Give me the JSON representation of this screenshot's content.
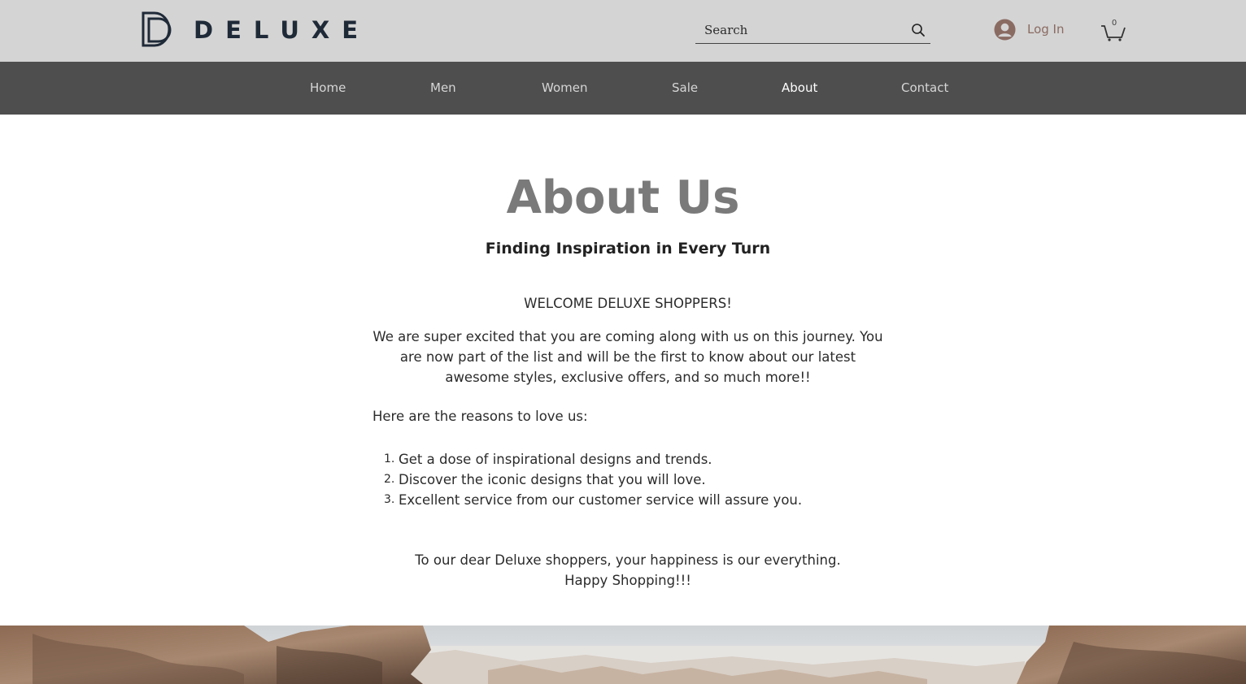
{
  "brand": {
    "name": "DELUXE",
    "logo_color": "#1f2a38"
  },
  "header": {
    "search_placeholder": "Search",
    "login_label": "Log In",
    "cart_count": "0"
  },
  "nav": {
    "items": [
      "Home",
      "Men",
      "Women",
      "Sale",
      "About",
      "Contact"
    ],
    "active": "About"
  },
  "page": {
    "title": "About Us",
    "subtitle": "Finding Inspiration in Every Turn",
    "welcome": "WELCOME DELUXE SHOPPERS!",
    "intro": "We are super excited that you are coming along with us on this journey. You are now part of the list and will be the first to know about our latest awesome styles, exclusive offers, and so much more!!",
    "reasons_heading": "Here are the reasons to love us:",
    "reasons": [
      "Get a dose of inspirational designs and trends.",
      "Discover the iconic designs that you will love.",
      "Excellent service from our customer service will assure you."
    ],
    "closing_line": "To our dear Deluxe shoppers, your happiness is our everything.",
    "closing_signoff": "Happy Shopping!!!"
  },
  "colors": {
    "header_bg": "#d4d4d4",
    "nav_bg": "#4f4e4e",
    "title": "#7a7a7a",
    "login_text": "#8a6b62"
  }
}
